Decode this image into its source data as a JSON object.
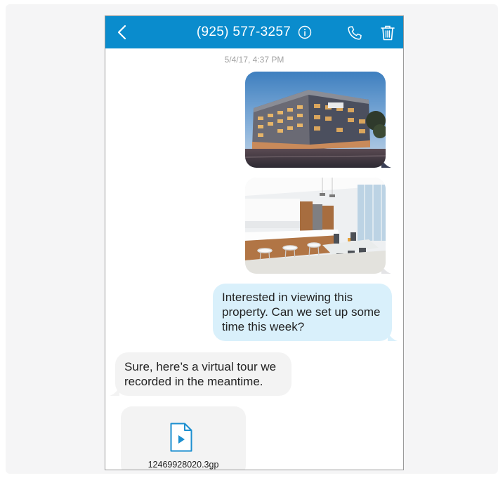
{
  "header": {
    "title": "(925) 577-3257",
    "back_icon": "chevron-left-icon",
    "info_icon": "info-icon",
    "call_icon": "phone-icon",
    "delete_icon": "trash-icon",
    "accent_color": "#0a8ccd"
  },
  "conversation": {
    "timestamp": "5/4/17, 4:37 PM",
    "images": [
      {
        "content": "modern apartment building exterior at dusk",
        "direction": "outgoing"
      },
      {
        "content": "bright apartment interior with kitchen and dining table",
        "direction": "outgoing"
      }
    ],
    "outgoing_message": "Interested in viewing this property. Can we set up some time this week?",
    "incoming_message": "Sure, here’s a virtual tour we recorded in the meantime.",
    "attachment": {
      "file_name": "12469928020.3gp",
      "icon": "video-file-icon"
    },
    "colors": {
      "outgoing_bubble": "#d9f0fb",
      "incoming_bubble": "#f3f3f3"
    }
  }
}
